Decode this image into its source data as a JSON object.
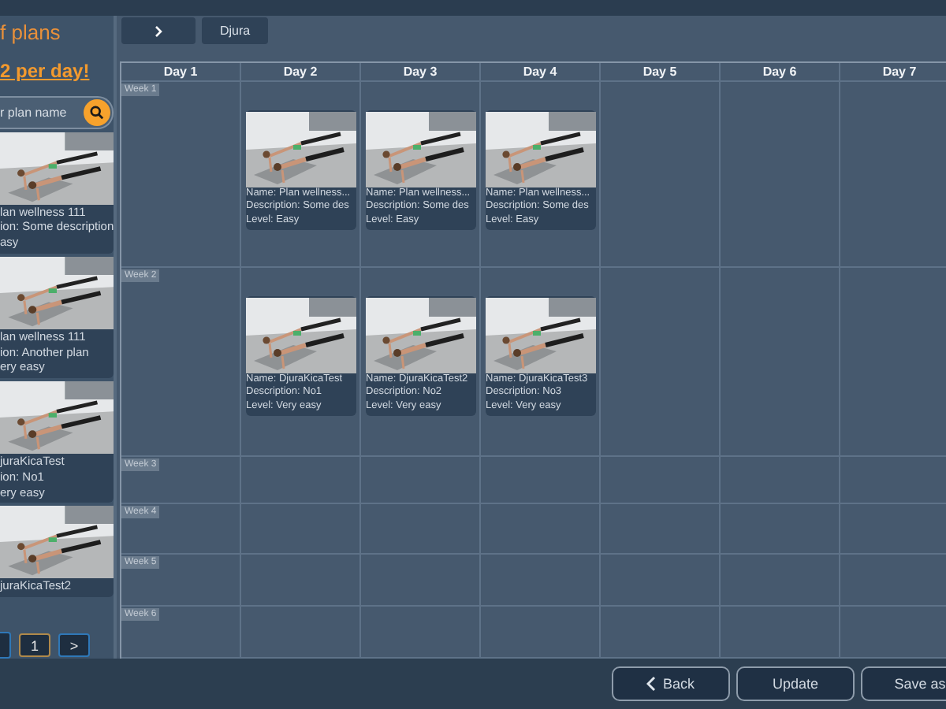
{
  "sidebar": {
    "title": "f plans",
    "subtitle": "2 per day!",
    "search": {
      "placeholder": "r plan name"
    },
    "plans": [
      {
        "name": "lan wellness 111",
        "description": "ion: Some description",
        "level": "asy"
      },
      {
        "name": "lan wellness 111",
        "description": "ion: Another plan",
        "level": "ery easy"
      },
      {
        "name": "juraKicaTest",
        "description": "ion: No1",
        "level": "ery easy"
      },
      {
        "name": "juraKicaTest2"
      }
    ],
    "pagination": [
      {
        "label": "1",
        "selected": true
      },
      {
        "label": ">",
        "selected": false
      }
    ]
  },
  "toolbar": {
    "buttons": [
      {
        "kind": "next"
      },
      {
        "kind": "text",
        "label": "Djura"
      }
    ]
  },
  "calendar": {
    "days": [
      "Day 1",
      "Day 2",
      "Day 3",
      "Day 4",
      "Day 5",
      "Day 6",
      "Day 7"
    ],
    "weeks": [
      {
        "label": "Week 1",
        "cells": [
          {
            "kind": "empty"
          },
          {
            "kind": "plan",
            "name": "Name: Plan wellness...",
            "description": "Description: Some des",
            "level": "Level: Easy"
          },
          {
            "kind": "plan",
            "name": "Name: Plan wellness...",
            "description": "Description: Some des",
            "level": "Level: Easy"
          },
          {
            "kind": "plan",
            "name": "Name: Plan wellness...",
            "description": "Description: Some des",
            "level": "Level: Easy"
          },
          {
            "kind": "empty"
          },
          {
            "kind": "empty"
          },
          {
            "kind": "empty"
          }
        ]
      },
      {
        "label": "Week 2",
        "cells": [
          {
            "kind": "empty"
          },
          {
            "kind": "plan",
            "name": "Name: DjuraKicaTest",
            "description": "Description: No1",
            "level": "Level: Very easy"
          },
          {
            "kind": "plan",
            "name": "Name: DjuraKicaTest2",
            "description": "Description: No2",
            "level": "Level: Very easy"
          },
          {
            "kind": "plan",
            "name": "Name: DjuraKicaTest3",
            "description": "Description: No3",
            "level": "Level: Very easy"
          },
          {
            "kind": "empty"
          },
          {
            "kind": "empty"
          },
          {
            "kind": "empty"
          }
        ]
      },
      {
        "label": "Week 3"
      },
      {
        "label": "Week 4"
      },
      {
        "label": "Week 5"
      },
      {
        "label": "Week 6"
      }
    ]
  },
  "footer": {
    "buttons": [
      {
        "kind": "back",
        "label": "Back"
      },
      {
        "kind": "text",
        "label": "Update"
      },
      {
        "kind": "text",
        "label": "Save as"
      }
    ]
  }
}
